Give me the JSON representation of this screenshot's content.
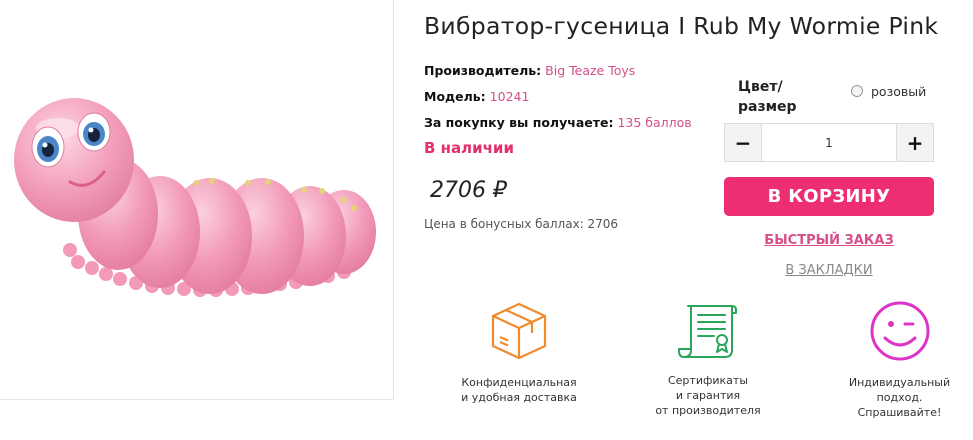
{
  "product": {
    "title": "Вибратор-гусеница I Rub My Wormie Pink",
    "image_alt": "pink caterpillar vibrator"
  },
  "meta": {
    "maker_label": "Производитель:",
    "maker_value": "Big Teaze Toys",
    "model_label": "Модель:",
    "model_value": "10241",
    "bonus_label": "За покупку вы получаете:",
    "bonus_value": "135 баллов"
  },
  "stock": "В наличии",
  "price": "2706 ₽",
  "price_bonus": "Цена в бонусных баллах: 2706",
  "options": {
    "label_line1": "Цвет/",
    "label_line2": "размер",
    "radio_label": "розовый",
    "radio_selected": false
  },
  "quantity": {
    "minus": "−",
    "value": "1",
    "plus": "+"
  },
  "actions": {
    "cart": "В КОРЗИНУ",
    "quick_order": "БЫСТРЫЙ ЗАКАЗ",
    "bookmark": "В ЗАКЛАДКИ"
  },
  "features": [
    {
      "icon": "box-icon",
      "caption": "Конфиденциальная\nи удобная доставка"
    },
    {
      "icon": "certificate-icon",
      "caption": "Сертификаты\nи гарантия\nот производителя"
    },
    {
      "icon": "wink-smiley-icon",
      "caption": "Индивидуальный\nподход.\nСпрашивайте!"
    }
  ],
  "colors": {
    "accent": "#ee2e72",
    "link": "#d24f8a",
    "box_icon": "#f08a2c",
    "certificate_icon": "#2aa65a",
    "smiley_icon": "#dd34c8",
    "product_pink": "#f29bb8"
  }
}
